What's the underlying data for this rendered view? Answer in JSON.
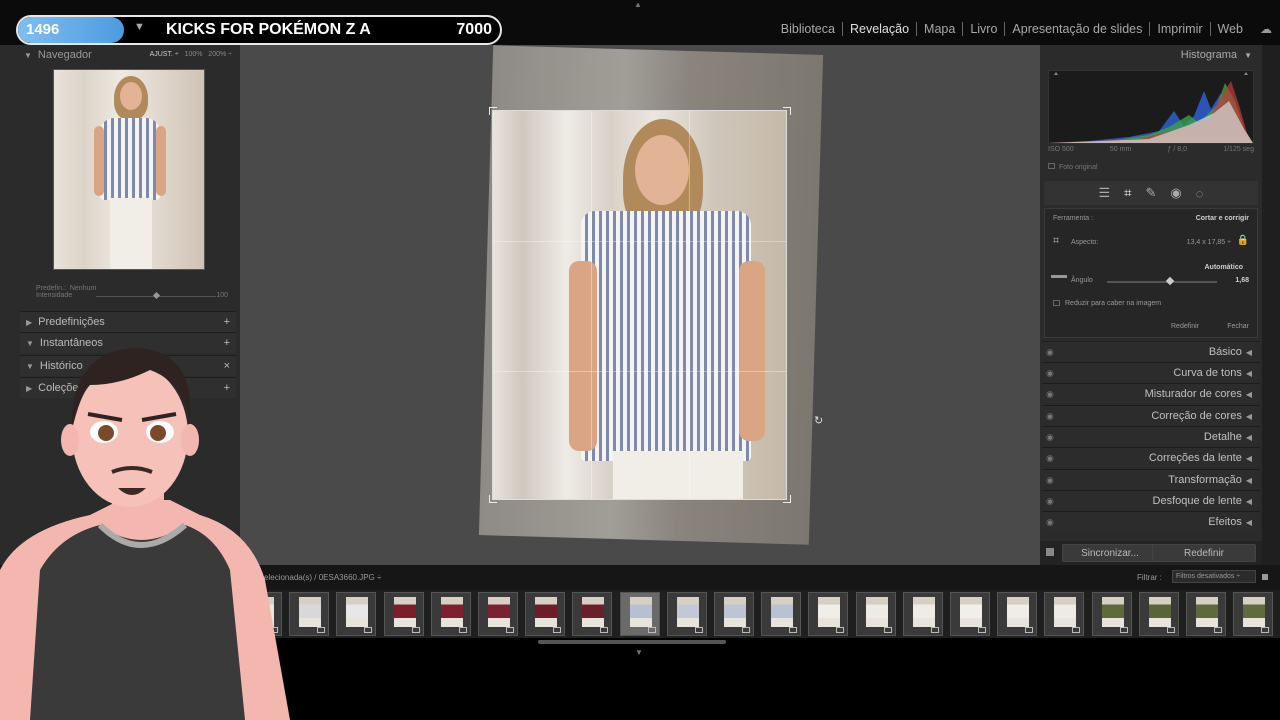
{
  "overlay": {
    "count": "1496",
    "title": "KICKS FOR POKÉMON Z A",
    "goal": "7000"
  },
  "modules": [
    "Biblioteca",
    "Revelação",
    "Mapa",
    "Livro",
    "Apresentação de slides",
    "Imprimir",
    "Web"
  ],
  "active_module": "Revelação",
  "left": {
    "navigator": {
      "title": "Navegador",
      "fit": "AJUST. ÷",
      "zoom100": "100%",
      "zoom200": "200%"
    },
    "preset": {
      "label": "Predefin.:",
      "value": "Nenhum",
      "amount_label": "Intensidade",
      "amount_value": "100"
    },
    "sections": [
      {
        "label": "Predefinições",
        "action": "+"
      },
      {
        "label": "Instantâneos",
        "action": "+"
      },
      {
        "label": "Histórico",
        "action": "×"
      },
      {
        "label": "Coleções",
        "action": "+"
      }
    ]
  },
  "right": {
    "histogram_title": "Histograma",
    "hist_info": [
      "ISO 500",
      "50 mm",
      "ƒ / 8,0",
      "1/125 seg"
    ],
    "original_photo": "Foto original",
    "crop": {
      "tool_label": "Ferramenta :",
      "tool_value": "Cortar e corrigir",
      "aspect_label": "Aspecto:",
      "aspect_value": "13,4 x 17,85 ÷",
      "auto": "Automático",
      "angle_label": "Ângulo",
      "angle_value": "1,68",
      "angle_fraction": 0.58,
      "constrain": "Reduzir para caber na imagem",
      "reset": "Redefinir",
      "close": "Fechar"
    },
    "sections": [
      "Básico",
      "Curva de tons",
      "Misturador de cores",
      "Correção de cores",
      "Detalhe",
      "Correções da lente",
      "Transformação",
      "Desfoque de lente",
      "Efeitos"
    ],
    "sync": "Sincronizar...",
    "reset": "Redefinir"
  },
  "filmstrip": {
    "path_text": "/ 177 selecionada(s) / 0ESA3660.JPG ÷",
    "filter_label": "Filtrar :",
    "filter_value": "Filtros desativados ÷",
    "thumb_colors": [
      "#e9e6e2",
      "#d8d8d8",
      "#e7e7e7",
      "#7a1e2a",
      "#7d2030",
      "#7a2230",
      "#6e1c28",
      "#6a1f2a",
      "#b7bfd3",
      "#c2c8d8",
      "#bcc4d6",
      "#b9c2d5",
      "#f0eee8",
      "#ecebe4",
      "#efece6",
      "#f1efe9",
      "#efede7",
      "#eeeae4",
      "#5e6a3a",
      "#596538",
      "#5f6a3c",
      "#606b3d"
    ]
  }
}
